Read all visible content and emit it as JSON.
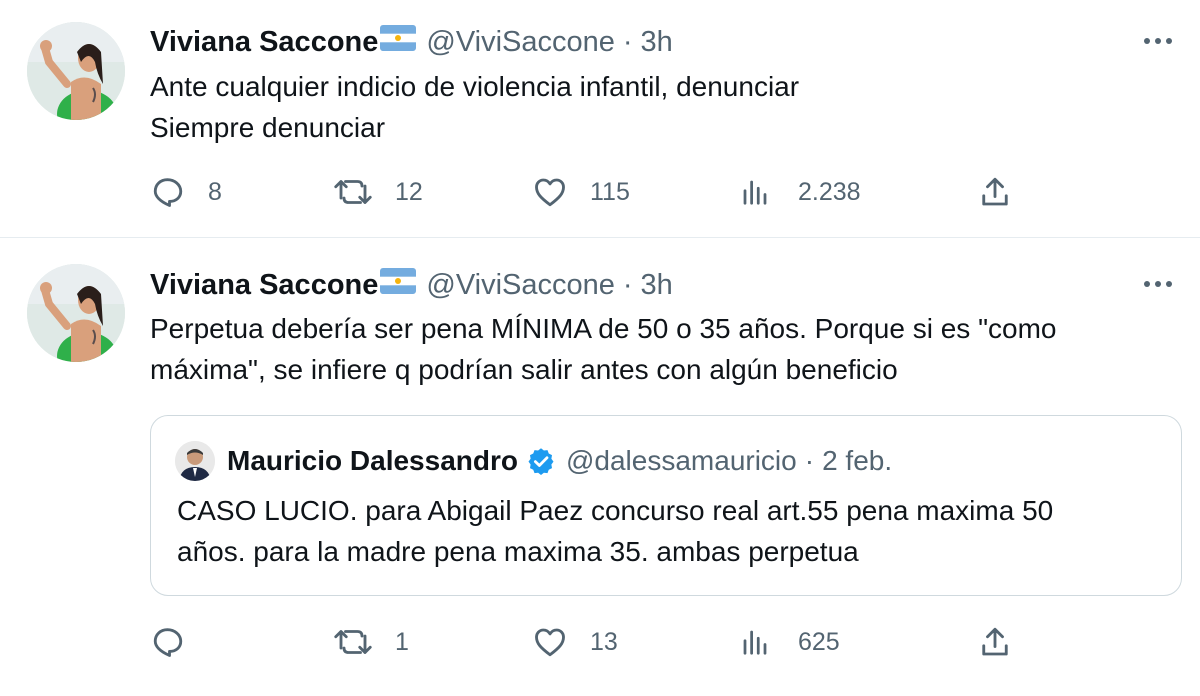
{
  "tweets": [
    {
      "author_name": "Viviana Saccone",
      "handle": "@ViviSaccone",
      "separator": "·",
      "time": "3h",
      "text_lines": [
        "Ante cualquier indicio de violencia infantil, denunciar",
        "Siempre denunciar"
      ],
      "stats": {
        "replies": "8",
        "retweets": "12",
        "likes": "115",
        "views": "2.238"
      }
    },
    {
      "author_name": "Viviana Saccone",
      "handle": "@ViviSaccone",
      "separator": "·",
      "time": "3h",
      "text_lines": [
        "Perpetua debería ser pena MÍNIMA de 50 o 35 años. Porque si es \"como",
        "máxima\", se infiere q podrían salir antes con algún beneficio"
      ],
      "quoted": {
        "author_name": "Mauricio Dalessandro",
        "handle": "@dalessamauricio",
        "separator": "·",
        "time": "2 feb.",
        "text_lines": [
          "CASO LUCIO. para Abigail Paez concurso real art.55 pena maxima 50",
          "años. para la madre pena maxima 35. ambas perpetua"
        ]
      },
      "stats": {
        "replies": "",
        "retweets": "1",
        "likes": "13",
        "views": "625"
      }
    }
  ],
  "icons": {
    "reply": "reply-icon",
    "retweet": "retweet-icon",
    "like": "heart-icon",
    "views": "views-icon",
    "share": "share-icon",
    "more": "more-icon",
    "flag": "argentina-flag-icon",
    "verified": "verified-badge-icon"
  },
  "colors": {
    "text": "#0f1419",
    "secondary": "#536471",
    "verified": "#1d9bf0",
    "divider": "#e6ecf0",
    "quote_border": "#cfd9de",
    "flag_blue": "#74acdf",
    "flag_sun": "#f6b40e"
  }
}
